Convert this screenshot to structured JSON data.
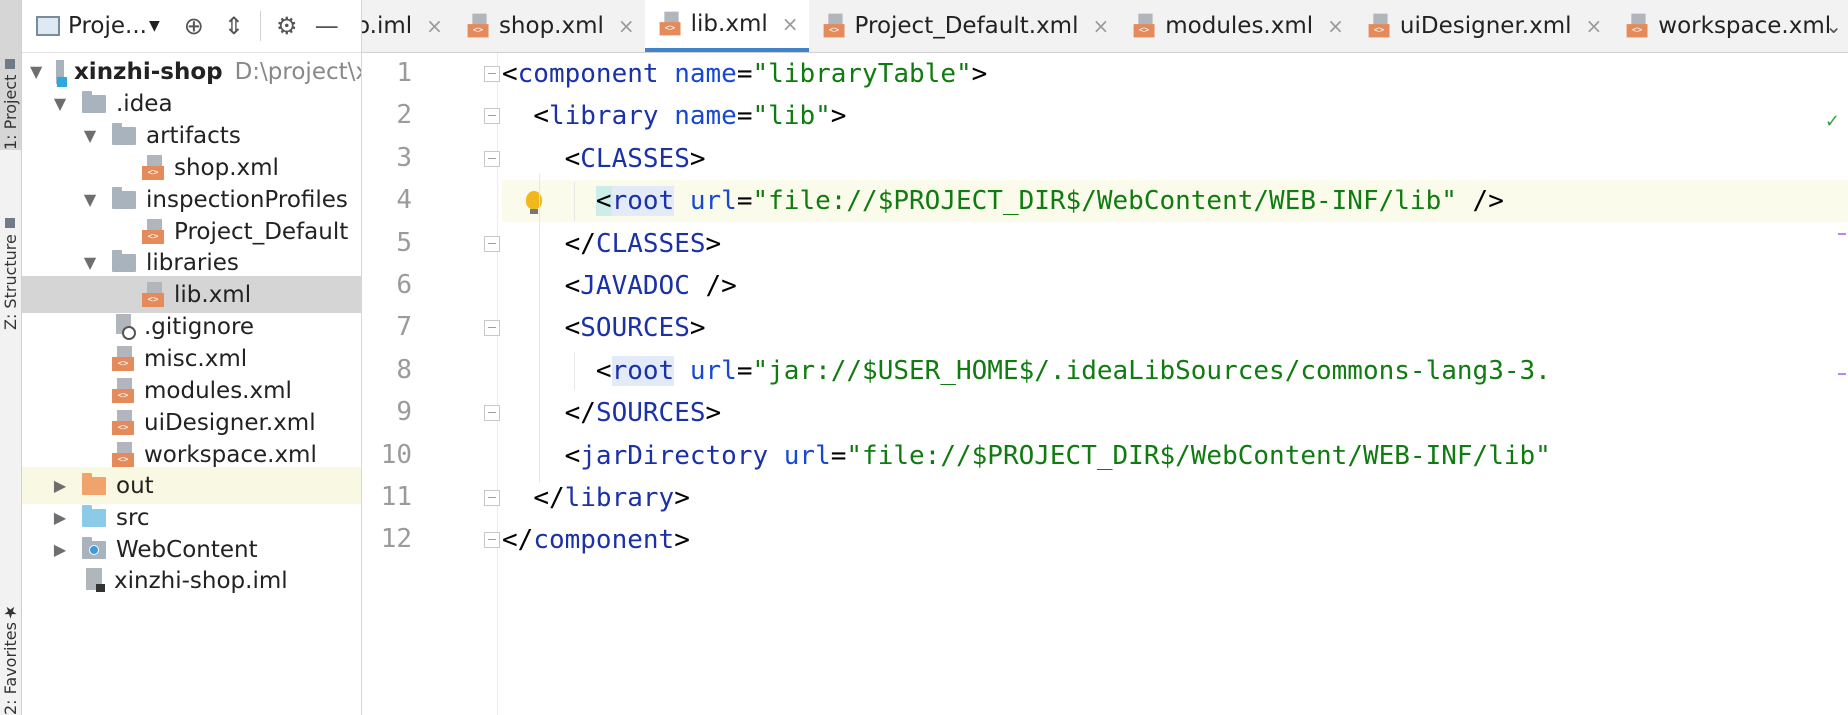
{
  "side_tabs": {
    "project": "1: Project",
    "structure": "Z: Structure",
    "favorites": "2: Favorites"
  },
  "project_panel": {
    "title": "Proje...",
    "tree": [
      {
        "label": "xinzhi-shop",
        "path": "D:\\project\\x",
        "level": 0,
        "expanded": true,
        "icon": "module-icon"
      },
      {
        "label": ".idea",
        "level": 1,
        "expanded": true,
        "icon": "folder-icon"
      },
      {
        "label": "artifacts",
        "level": 2,
        "expanded": true,
        "icon": "folder-icon"
      },
      {
        "label": "shop.xml",
        "level": 3,
        "icon": "xml-file-icon"
      },
      {
        "label": "inspectionProfiles",
        "level": 2,
        "expanded": true,
        "icon": "folder-icon"
      },
      {
        "label": "Project_Default",
        "level": 3,
        "icon": "xml-file-icon"
      },
      {
        "label": "libraries",
        "level": 2,
        "expanded": true,
        "icon": "folder-icon"
      },
      {
        "label": "lib.xml",
        "level": 3,
        "icon": "xml-file-icon",
        "selected": true
      },
      {
        "label": ".gitignore",
        "level": 2,
        "icon": "gitignore-file-icon"
      },
      {
        "label": "misc.xml",
        "level": 2,
        "icon": "xml-file-icon"
      },
      {
        "label": "modules.xml",
        "level": 2,
        "icon": "xml-file-icon"
      },
      {
        "label": "uiDesigner.xml",
        "level": 2,
        "icon": "xml-file-icon"
      },
      {
        "label": "workspace.xml",
        "level": 2,
        "icon": "xml-file-icon"
      },
      {
        "label": "out",
        "level": 1,
        "expanded": false,
        "icon": "orange-folder-icon",
        "hover": true
      },
      {
        "label": "src",
        "level": 1,
        "expanded": false,
        "icon": "blue-folder-icon"
      },
      {
        "label": "WebContent",
        "level": 1,
        "expanded": false,
        "icon": "web-folder-icon"
      },
      {
        "label": "xinzhi-shop.iml",
        "level": 1,
        "icon": "iml-file-icon"
      }
    ]
  },
  "tabs": [
    {
      "label": "o.iml",
      "active": false
    },
    {
      "label": "shop.xml",
      "active": false
    },
    {
      "label": "lib.xml",
      "active": true
    },
    {
      "label": "Project_Default.xml",
      "active": false
    },
    {
      "label": "modules.xml",
      "active": false
    },
    {
      "label": "uiDesigner.xml",
      "active": false
    },
    {
      "label": "workspace.xml",
      "active": false
    }
  ],
  "editor": {
    "line_numbers": [
      "1",
      "2",
      "3",
      "4",
      "5",
      "6",
      "7",
      "8",
      "9",
      "10",
      "11",
      "12"
    ],
    "current_line": 4,
    "code": [
      [
        [
          "br",
          "<"
        ],
        [
          "tag",
          "component"
        ],
        [
          "sp",
          " "
        ],
        [
          "attr",
          "name"
        ],
        [
          "br",
          "="
        ],
        [
          "val",
          "\"libraryTable\""
        ],
        [
          "br",
          ">"
        ]
      ],
      [
        [
          "sp",
          "  "
        ],
        [
          "br",
          "<"
        ],
        [
          "tag",
          "library"
        ],
        [
          "sp",
          " "
        ],
        [
          "attr",
          "name"
        ],
        [
          "br",
          "="
        ],
        [
          "val",
          "\"lib\""
        ],
        [
          "br",
          ">"
        ]
      ],
      [
        [
          "sp",
          "    "
        ],
        [
          "br",
          "<"
        ],
        [
          "tag",
          "CLASSES"
        ],
        [
          "br",
          ">"
        ]
      ],
      [
        [
          "sp",
          "      "
        ],
        [
          "hl2",
          "<"
        ],
        [
          "taghl",
          "root"
        ],
        [
          "sp",
          " "
        ],
        [
          "attr",
          "url"
        ],
        [
          "br",
          "="
        ],
        [
          "val",
          "\"file://$PROJECT_DIR$/WebContent/WEB-INF/lib\""
        ],
        [
          "sp",
          " "
        ],
        [
          "br",
          "/>"
        ]
      ],
      [
        [
          "sp",
          "    "
        ],
        [
          "br",
          "</"
        ],
        [
          "tag",
          "CLASSES"
        ],
        [
          "br",
          ">"
        ]
      ],
      [
        [
          "sp",
          "    "
        ],
        [
          "br",
          "<"
        ],
        [
          "tag",
          "JAVADOC"
        ],
        [
          "sp",
          " "
        ],
        [
          "br",
          "/>"
        ]
      ],
      [
        [
          "sp",
          "    "
        ],
        [
          "br",
          "<"
        ],
        [
          "tag",
          "SOURCES"
        ],
        [
          "br",
          ">"
        ]
      ],
      [
        [
          "sp",
          "      "
        ],
        [
          "br",
          "<"
        ],
        [
          "taghl",
          "root"
        ],
        [
          "sp",
          " "
        ],
        [
          "attr",
          "url"
        ],
        [
          "br",
          "="
        ],
        [
          "val",
          "\"jar://$USER_HOME$/.ideaLibSources/commons-lang3-3."
        ]
      ],
      [
        [
          "sp",
          "    "
        ],
        [
          "br",
          "</"
        ],
        [
          "tag",
          "SOURCES"
        ],
        [
          "br",
          ">"
        ]
      ],
      [
        [
          "sp",
          "    "
        ],
        [
          "br",
          "<"
        ],
        [
          "tag",
          "jarDirectory"
        ],
        [
          "sp",
          " "
        ],
        [
          "attr",
          "url"
        ],
        [
          "br",
          "="
        ],
        [
          "val",
          "\"file://$PROJECT_DIR$/WebContent/WEB-INF/lib\""
        ]
      ],
      [
        [
          "sp",
          "  "
        ],
        [
          "br",
          "</"
        ],
        [
          "tag",
          "library"
        ],
        [
          "br",
          ">"
        ]
      ],
      [
        [
          "br",
          "</"
        ],
        [
          "tag",
          "component"
        ],
        [
          "br",
          ">"
        ]
      ]
    ]
  }
}
